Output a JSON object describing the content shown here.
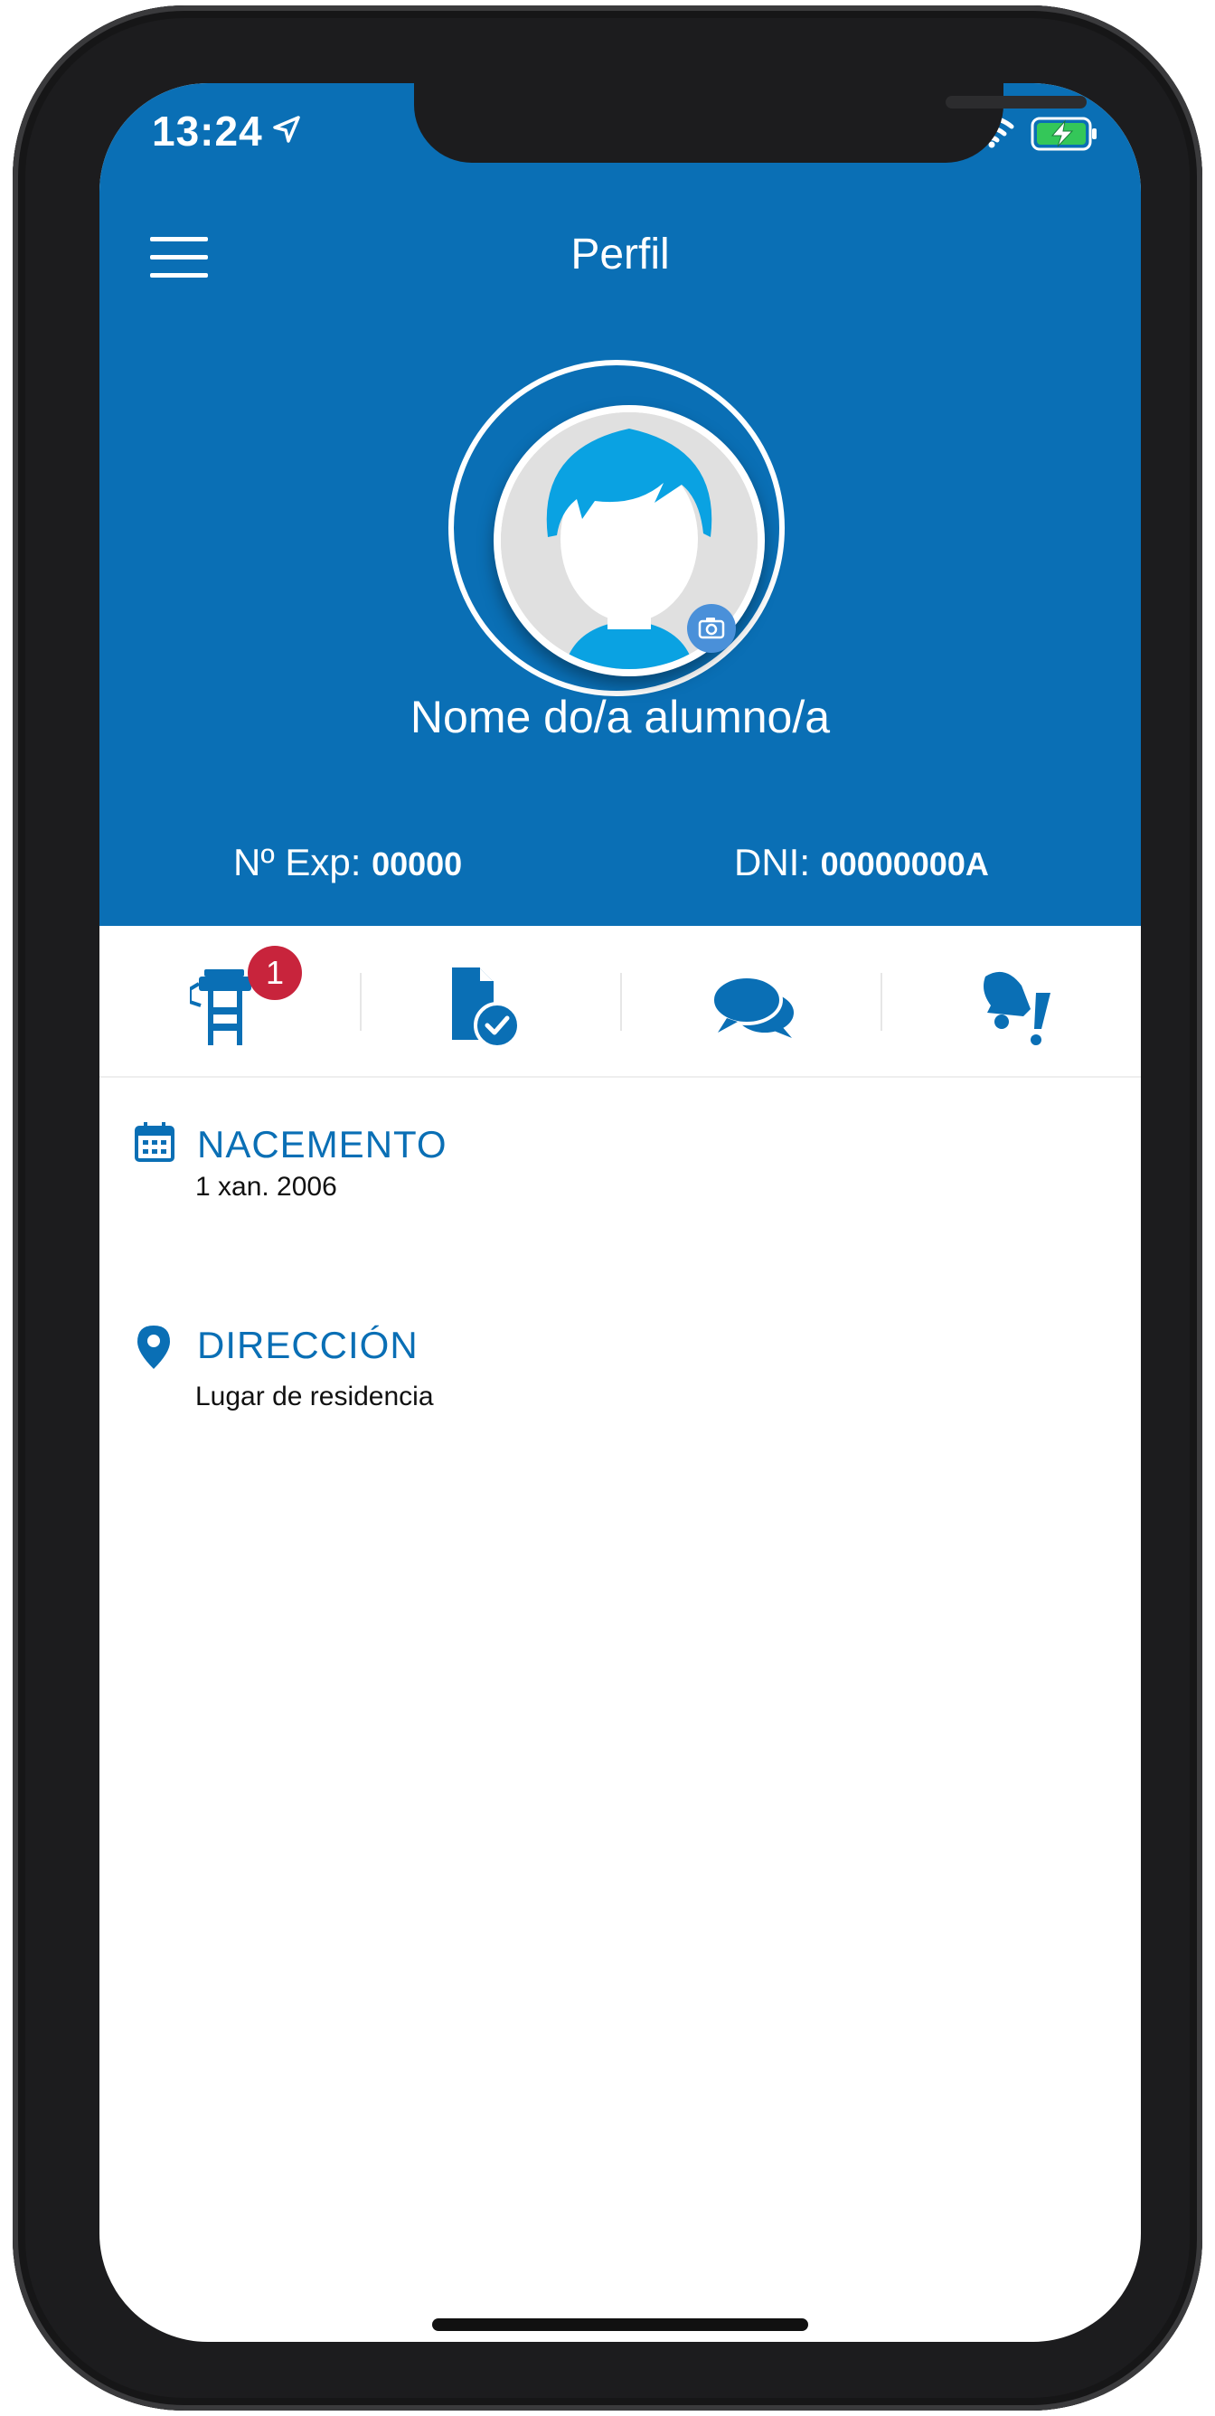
{
  "status_bar": {
    "time": "13:24"
  },
  "header": {
    "title": "Perfil",
    "student_name": "Nome do/a alumno/a",
    "exp_label": "Nº Exp:",
    "exp_value": "00000",
    "dni_label": "DNI:",
    "dni_value": "00000000A"
  },
  "tabs": [
    {
      "icon": "school-desk-icon",
      "badge": "1"
    },
    {
      "icon": "document-check-icon"
    },
    {
      "icon": "chat-bubbles-icon"
    },
    {
      "icon": "bell-alert-icon"
    }
  ],
  "fields": {
    "birth": {
      "label": "NACEMENTO",
      "value": "1 xan. 2006",
      "icon": "calendar-icon"
    },
    "address": {
      "label": "DIRECCIÓN",
      "value": "Lugar de residencia",
      "icon": "location-pin-icon"
    }
  },
  "colors": {
    "primary": "#0a6fb5",
    "badge": "#c8243c",
    "avatar_hair": "#0aa2e2"
  }
}
